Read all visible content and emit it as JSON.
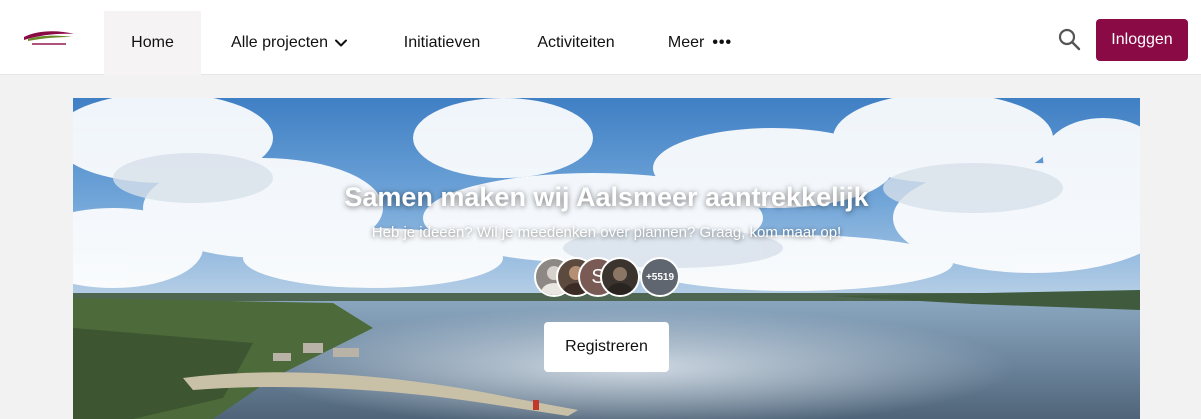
{
  "nav": {
    "items": [
      {
        "label": "Home"
      },
      {
        "label": "Alle projecten"
      },
      {
        "label": "Initiatieven"
      },
      {
        "label": "Activiteiten"
      },
      {
        "label": "Meer"
      }
    ],
    "more_dots": "•••",
    "login_label": "Inloggen"
  },
  "hero": {
    "title": "Samen maken wij Aalsmeer aantrekkelijk",
    "subtitle": "Heb je ideeën? Wil je meedenken over plannen? Graag, kom maar op!",
    "avatar_letter": "S",
    "participants_count": "+5519",
    "register_label": "Registreren"
  },
  "colors": {
    "brand": "#8a0a45",
    "nav_active_bg": "#f5f3f3",
    "page_bg": "#f3f2f2"
  },
  "icons": {
    "search": "search-icon",
    "chevron": "chevron-down-icon",
    "logo": "logo-icon"
  }
}
